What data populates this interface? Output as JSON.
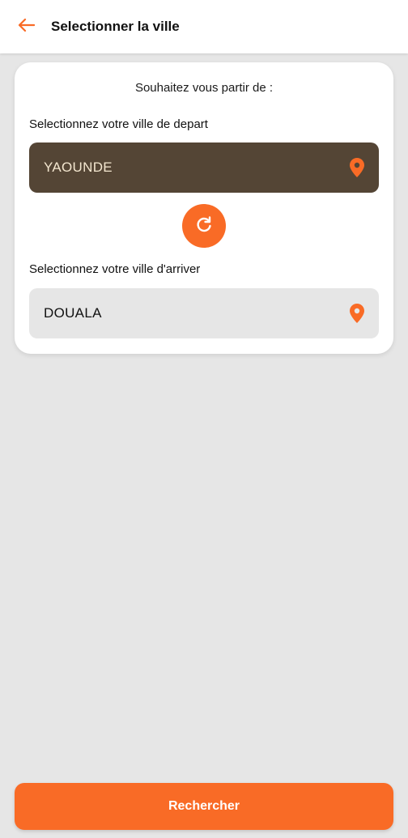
{
  "header": {
    "title": "Selectionner la ville",
    "back_icon": "arrow-left-icon"
  },
  "card": {
    "question": "Souhaitez vous partir de :",
    "departure": {
      "label": "Selectionnez votre ville de depart",
      "value": "YAOUNDE",
      "icon": "location-pin-icon"
    },
    "swap": {
      "icon": "refresh-icon"
    },
    "arrival": {
      "label": "Selectionnez votre ville d'arriver",
      "value": "DOUALA",
      "icon": "location-pin-icon"
    }
  },
  "footer": {
    "search_label": "Rechercher"
  },
  "colors": {
    "accent": "#f96b26",
    "selected_field": "#544535",
    "selected_text": "#f3e6cf",
    "background": "#e6e6e6"
  }
}
